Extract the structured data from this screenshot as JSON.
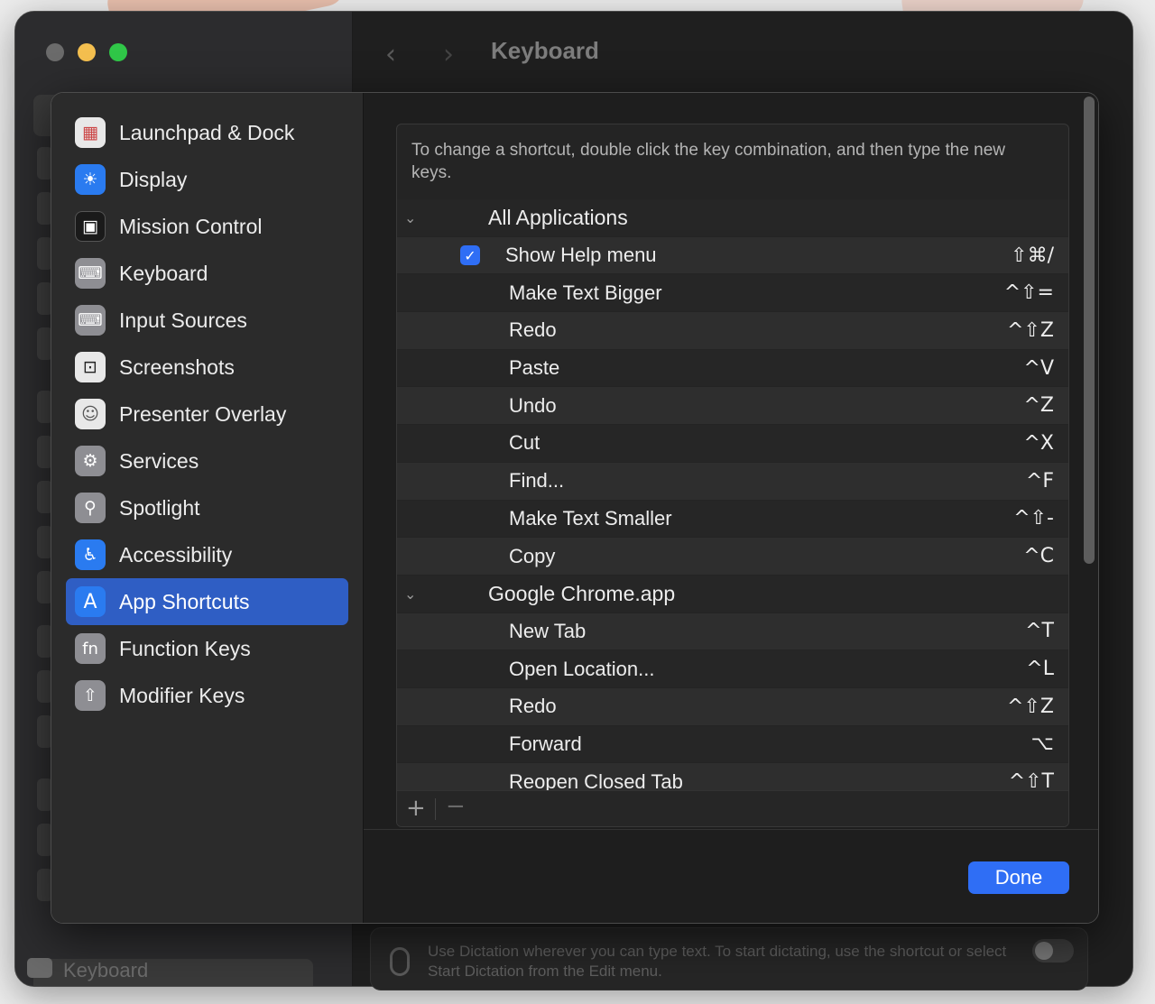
{
  "window": {
    "title": "Keyboard",
    "back_arrow": "‹",
    "forward_arrow": "›",
    "background": {
      "sidebar_keyboard_label": "Keyboard",
      "dictation_text": "Use Dictation wherever you can type text. To start dictating, use the shortcut or select Start Dictation from the Edit menu."
    }
  },
  "sidebar": {
    "items": [
      {
        "label": "Launchpad & Dock",
        "icon": "launchpad-icon",
        "glyph": "▦",
        "color": "#e8e8e8"
      },
      {
        "label": "Display",
        "icon": "display-brightness-icon",
        "glyph": "☀",
        "color": "#2a7bf0"
      },
      {
        "label": "Mission Control",
        "icon": "mission-control-icon",
        "glyph": "▣",
        "color": "#1a1a1a"
      },
      {
        "label": "Keyboard",
        "icon": "keyboard-icon",
        "glyph": "⌨",
        "color": "#8e8e93"
      },
      {
        "label": "Input Sources",
        "icon": "input-sources-icon",
        "glyph": "⌨",
        "color": "#8e8e93"
      },
      {
        "label": "Screenshots",
        "icon": "screenshot-icon",
        "glyph": "⊡",
        "color": "#e8e8e8"
      },
      {
        "label": "Presenter Overlay",
        "icon": "presenter-overlay-icon",
        "glyph": "☺",
        "color": "#e8e8e8"
      },
      {
        "label": "Services",
        "icon": "services-gear-icon",
        "glyph": "⚙",
        "color": "#8e8e93"
      },
      {
        "label": "Spotlight",
        "icon": "spotlight-search-icon",
        "glyph": "⚲",
        "color": "#8e8e93"
      },
      {
        "label": "Accessibility",
        "icon": "accessibility-icon",
        "glyph": "♿",
        "color": "#2a7bf0"
      },
      {
        "label": "App Shortcuts",
        "icon": "app-shortcuts-icon",
        "glyph": "A",
        "color": "#2a7bf0"
      },
      {
        "label": "Function Keys",
        "icon": "function-keys-icon",
        "glyph": "fn",
        "color": "#8e8e93"
      },
      {
        "label": "Modifier Keys",
        "icon": "modifier-keys-icon",
        "glyph": "⇧",
        "color": "#8e8e93"
      }
    ],
    "selected": "App Shortcuts",
    "accent_color": "#2f5ec4"
  },
  "shortcuts": {
    "note": "To change a shortcut, double click the key combination, and then type the new keys.",
    "groups": [
      {
        "label": "All Applications",
        "chevron": "⌄"
      },
      {
        "label": "Google Chrome.app",
        "chevron": "⌄"
      }
    ],
    "all_apps": [
      {
        "label": "Show Help menu",
        "keys": "⇧⌘/",
        "checked": true
      },
      {
        "label": "Make Text Bigger",
        "keys": "^⇧="
      },
      {
        "label": "Redo",
        "keys": "^⇧Z"
      },
      {
        "label": "Paste",
        "keys": "^V"
      },
      {
        "label": "Undo",
        "keys": "^Z"
      },
      {
        "label": "Cut",
        "keys": "^X"
      },
      {
        "label": "Find...",
        "keys": "^F"
      },
      {
        "label": "Make Text Smaller",
        "keys": "^⇧-"
      },
      {
        "label": "Copy",
        "keys": "^C"
      }
    ],
    "chrome": [
      {
        "label": "New Tab",
        "keys": "^T"
      },
      {
        "label": "Open Location...",
        "keys": "^L"
      },
      {
        "label": "Redo",
        "keys": "^⇧Z"
      },
      {
        "label": "Forward",
        "keys": "⌥"
      },
      {
        "label": "Reopen Closed Tab",
        "keys": "^⇧T"
      }
    ],
    "add_label": "+",
    "remove_label": "−",
    "checkmark": "✓"
  },
  "footer": {
    "done_label": "Done"
  }
}
